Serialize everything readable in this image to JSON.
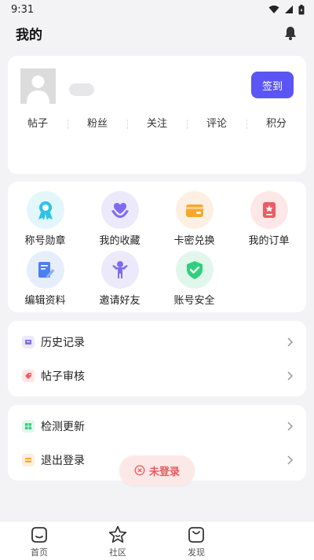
{
  "status_bar": {
    "time": "9:31"
  },
  "header": {
    "title": "我的"
  },
  "profile": {
    "signin_label": "签到",
    "stats": [
      "帖子",
      "粉丝",
      "关注",
      "评论",
      "积分"
    ]
  },
  "grid": [
    {
      "label": "称号勋章",
      "icon": "medal-icon",
      "bg": "#e3f6fb",
      "color": "#2cc3e6"
    },
    {
      "label": "我的收藏",
      "icon": "heart-hands-icon",
      "bg": "#ece9fb",
      "color": "#7d6cf0"
    },
    {
      "label": "卡密兑换",
      "icon": "wallet-icon",
      "bg": "#fdf0e2",
      "color": "#f7a72c"
    },
    {
      "label": "我的订单",
      "icon": "order-icon",
      "bg": "#fde7e7",
      "color": "#ef5a63"
    },
    {
      "label": "编辑资料",
      "icon": "edit-doc-icon",
      "bg": "#e6eefc",
      "color": "#4c7fef"
    },
    {
      "label": "邀请好友",
      "icon": "person-cheer-icon",
      "bg": "#ece9fb",
      "color": "#7d6cf0"
    },
    {
      "label": "账号安全",
      "icon": "shield-check-icon",
      "bg": "#e1f7ec",
      "color": "#2fcf7d"
    }
  ],
  "list_one": [
    {
      "label": "历史记录",
      "icon": "history-icon",
      "bg": "#ece9fb",
      "color": "#7d6cf0"
    },
    {
      "label": "帖子审核",
      "icon": "tag-icon",
      "bg": "#fde7e7",
      "color": "#ef5a63"
    }
  ],
  "list_two": [
    {
      "label": "检测更新",
      "icon": "update-grid-icon",
      "bg": "#e1f7ec",
      "color": "#2fcf7d"
    },
    {
      "label": "退出登录",
      "icon": "logout-icon",
      "bg": "#fdeedd",
      "color": "#f7a72c"
    }
  ],
  "toast": {
    "text": "未登录"
  },
  "tabbar": [
    {
      "label": "首页",
      "icon": "home-icon"
    },
    {
      "label": "社区",
      "icon": "star-icon"
    },
    {
      "label": "发现",
      "icon": "bag-icon"
    }
  ],
  "colors": {
    "accent": "#5b55f5",
    "background": "#f3f3f6",
    "toast_text": "#e85a5a"
  }
}
